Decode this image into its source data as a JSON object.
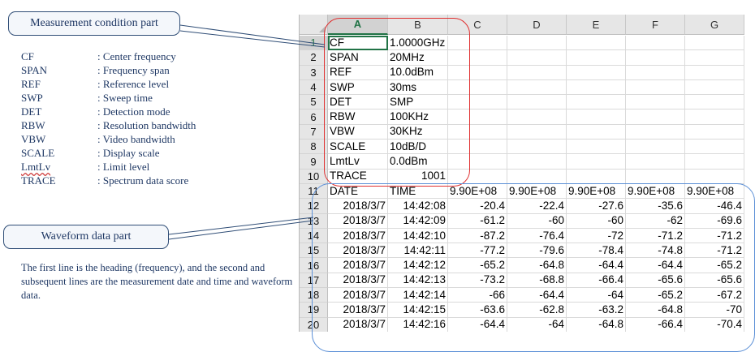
{
  "callouts": {
    "measurement": "Measurement condition part",
    "waveform": "Waveform data part"
  },
  "legend": [
    {
      "key": "CF",
      "desc": ": Center frequency"
    },
    {
      "key": "SPAN",
      "desc": ": Frequency span"
    },
    {
      "key": "REF",
      "desc": ":  Reference level"
    },
    {
      "key": "SWP",
      "desc": ": Sweep time"
    },
    {
      "key": "DET",
      "desc": ": Detection mode"
    },
    {
      "key": "RBW",
      "desc": ": Resolution bandwidth"
    },
    {
      "key": "VBW",
      "desc": ": Video bandwidth"
    },
    {
      "key": "SCALE",
      "desc": ": Display scale"
    },
    {
      "key": "LmtLv",
      "desc": ": Limit level"
    },
    {
      "key": "TRACE",
      "desc": ": Spectrum data score"
    }
  ],
  "description": "The first line is the heading (frequency),  and the second and subsequent lines are the measurement date and time and waveform data.",
  "sheet": {
    "columns": [
      "A",
      "B",
      "C",
      "D",
      "E",
      "F",
      "G"
    ],
    "selected_column": "A",
    "selected_row": "1",
    "rows": [
      {
        "num": "1",
        "cells": [
          "CF",
          "1.0000GHz",
          "",
          "",
          "",
          "",
          ""
        ]
      },
      {
        "num": "2",
        "cells": [
          "SPAN",
          "20MHz",
          "",
          "",
          "",
          "",
          ""
        ]
      },
      {
        "num": "3",
        "cells": [
          "REF",
          "10.0dBm",
          "",
          "",
          "",
          "",
          ""
        ]
      },
      {
        "num": "4",
        "cells": [
          "SWP",
          "30ms",
          "",
          "",
          "",
          "",
          ""
        ]
      },
      {
        "num": "5",
        "cells": [
          "DET",
          "SMP",
          "",
          "",
          "",
          "",
          ""
        ]
      },
      {
        "num": "6",
        "cells": [
          "RBW",
          "100KHz",
          "",
          "",
          "",
          "",
          ""
        ]
      },
      {
        "num": "7",
        "cells": [
          "VBW",
          "30KHz",
          "",
          "",
          "",
          "",
          ""
        ]
      },
      {
        "num": "8",
        "cells": [
          "SCALE",
          "10dB/D",
          "",
          "",
          "",
          "",
          ""
        ]
      },
      {
        "num": "9",
        "cells": [
          "LmtLv",
          "0.0dBm",
          "",
          "",
          "",
          "",
          ""
        ]
      },
      {
        "num": "10",
        "cells": [
          "TRACE",
          "1001",
          "",
          "",
          "",
          "",
          ""
        ]
      },
      {
        "num": "11",
        "cells": [
          "DATE",
          "TIME",
          "9.90E+08",
          "9.90E+08",
          "9.90E+08",
          "9.90E+08",
          "9.90E+08"
        ]
      },
      {
        "num": "12",
        "cells": [
          "2018/3/7",
          "14:42:08",
          "-20.4",
          "-22.4",
          "-27.6",
          "-35.6",
          "-46.4"
        ]
      },
      {
        "num": "13",
        "cells": [
          "2018/3/7",
          "14:42:09",
          "-61.2",
          "-60",
          "-60",
          "-62",
          "-69.6"
        ]
      },
      {
        "num": "14",
        "cells": [
          "2018/3/7",
          "14:42:10",
          "-87.2",
          "-76.4",
          "-72",
          "-71.2",
          "-71.2"
        ]
      },
      {
        "num": "15",
        "cells": [
          "2018/3/7",
          "14:42:11",
          "-77.2",
          "-79.6",
          "-78.4",
          "-74.8",
          "-71.2"
        ]
      },
      {
        "num": "16",
        "cells": [
          "2018/3/7",
          "14:42:12",
          "-65.2",
          "-64.8",
          "-64.4",
          "-64.4",
          "-65.2"
        ]
      },
      {
        "num": "17",
        "cells": [
          "2018/3/7",
          "14:42:13",
          "-73.2",
          "-68.8",
          "-66.4",
          "-65.6",
          "-65.6"
        ]
      },
      {
        "num": "18",
        "cells": [
          "2018/3/7",
          "14:42:14",
          "-66",
          "-64.4",
          "-64",
          "-65.2",
          "-67.2"
        ]
      },
      {
        "num": "19",
        "cells": [
          "2018/3/7",
          "14:42:15",
          "-63.6",
          "-62.8",
          "-63.2",
          "-64.8",
          "-70"
        ]
      },
      {
        "num": "20",
        "cells": [
          "2018/3/7",
          "14:42:16",
          "-64.4",
          "-64",
          "-64.8",
          "-66.4",
          "-70.4"
        ]
      }
    ]
  }
}
